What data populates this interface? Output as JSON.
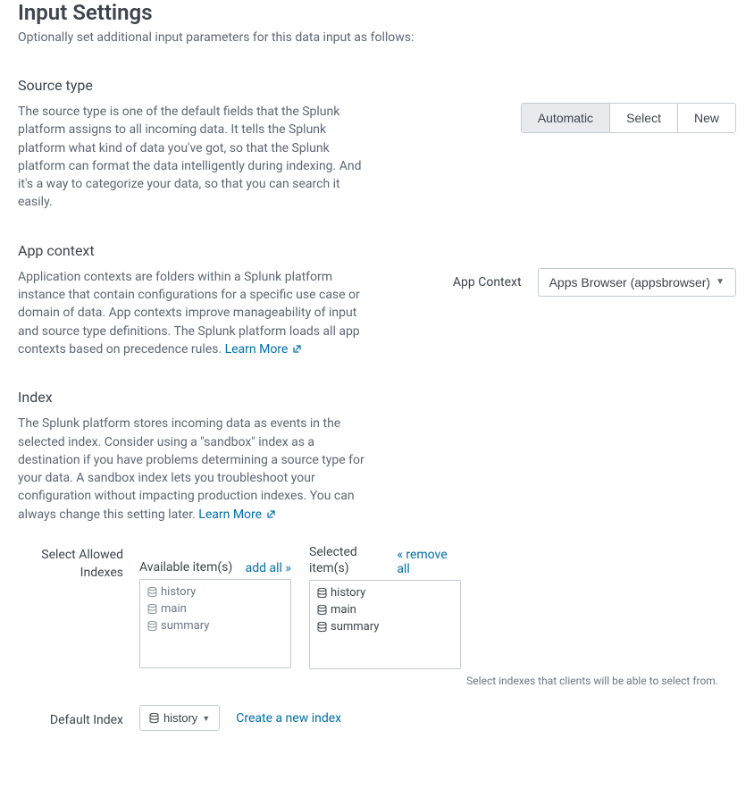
{
  "header": {
    "title": "Input Settings",
    "subtitle": "Optionally set additional input parameters for this data input as follows:"
  },
  "source_type": {
    "title": "Source type",
    "desc": "The source type is one of the default fields that the Splunk platform assigns to all incoming data. It tells the Splunk platform what kind of data you've got, so that the Splunk platform can format the data intelligently during indexing. And it's a way to categorize your data, so that you can search it easily.",
    "options": {
      "automatic": "Automatic",
      "select": "Select",
      "new": "New"
    }
  },
  "app_context": {
    "title": "App context",
    "desc": "Application contexts are folders within a Splunk platform instance that contain configurations for a specific use case or domain of data. App contexts improve manageability of input and source type definitions. The Splunk platform loads all app contexts based on precedence rules. ",
    "learn_more": "Learn More",
    "field_label": "App Context",
    "selected": "Apps Browser (appsbrowser)"
  },
  "index": {
    "title": "Index",
    "desc": "The Splunk platform stores incoming data as events in the selected index. Consider using a \"sandbox\" index as a destination if you have problems determining a source type for your data. A sandbox index lets you troubleshoot your configuration without impacting production indexes. You can always change this setting later. ",
    "learn_more": "Learn More",
    "allowed_label": "Select Allowed Indexes",
    "available_title": "Available item(s)",
    "add_all": "add all »",
    "selected_title": "Selected item(s)",
    "remove_all": "« remove all",
    "available": [
      "history",
      "main",
      "summary"
    ],
    "selected": [
      "history",
      "main",
      "summary"
    ],
    "hint": "Select indexes that clients will be able to select from.",
    "default_label": "Default Index",
    "default_value": "history",
    "create_link": "Create a new index"
  }
}
